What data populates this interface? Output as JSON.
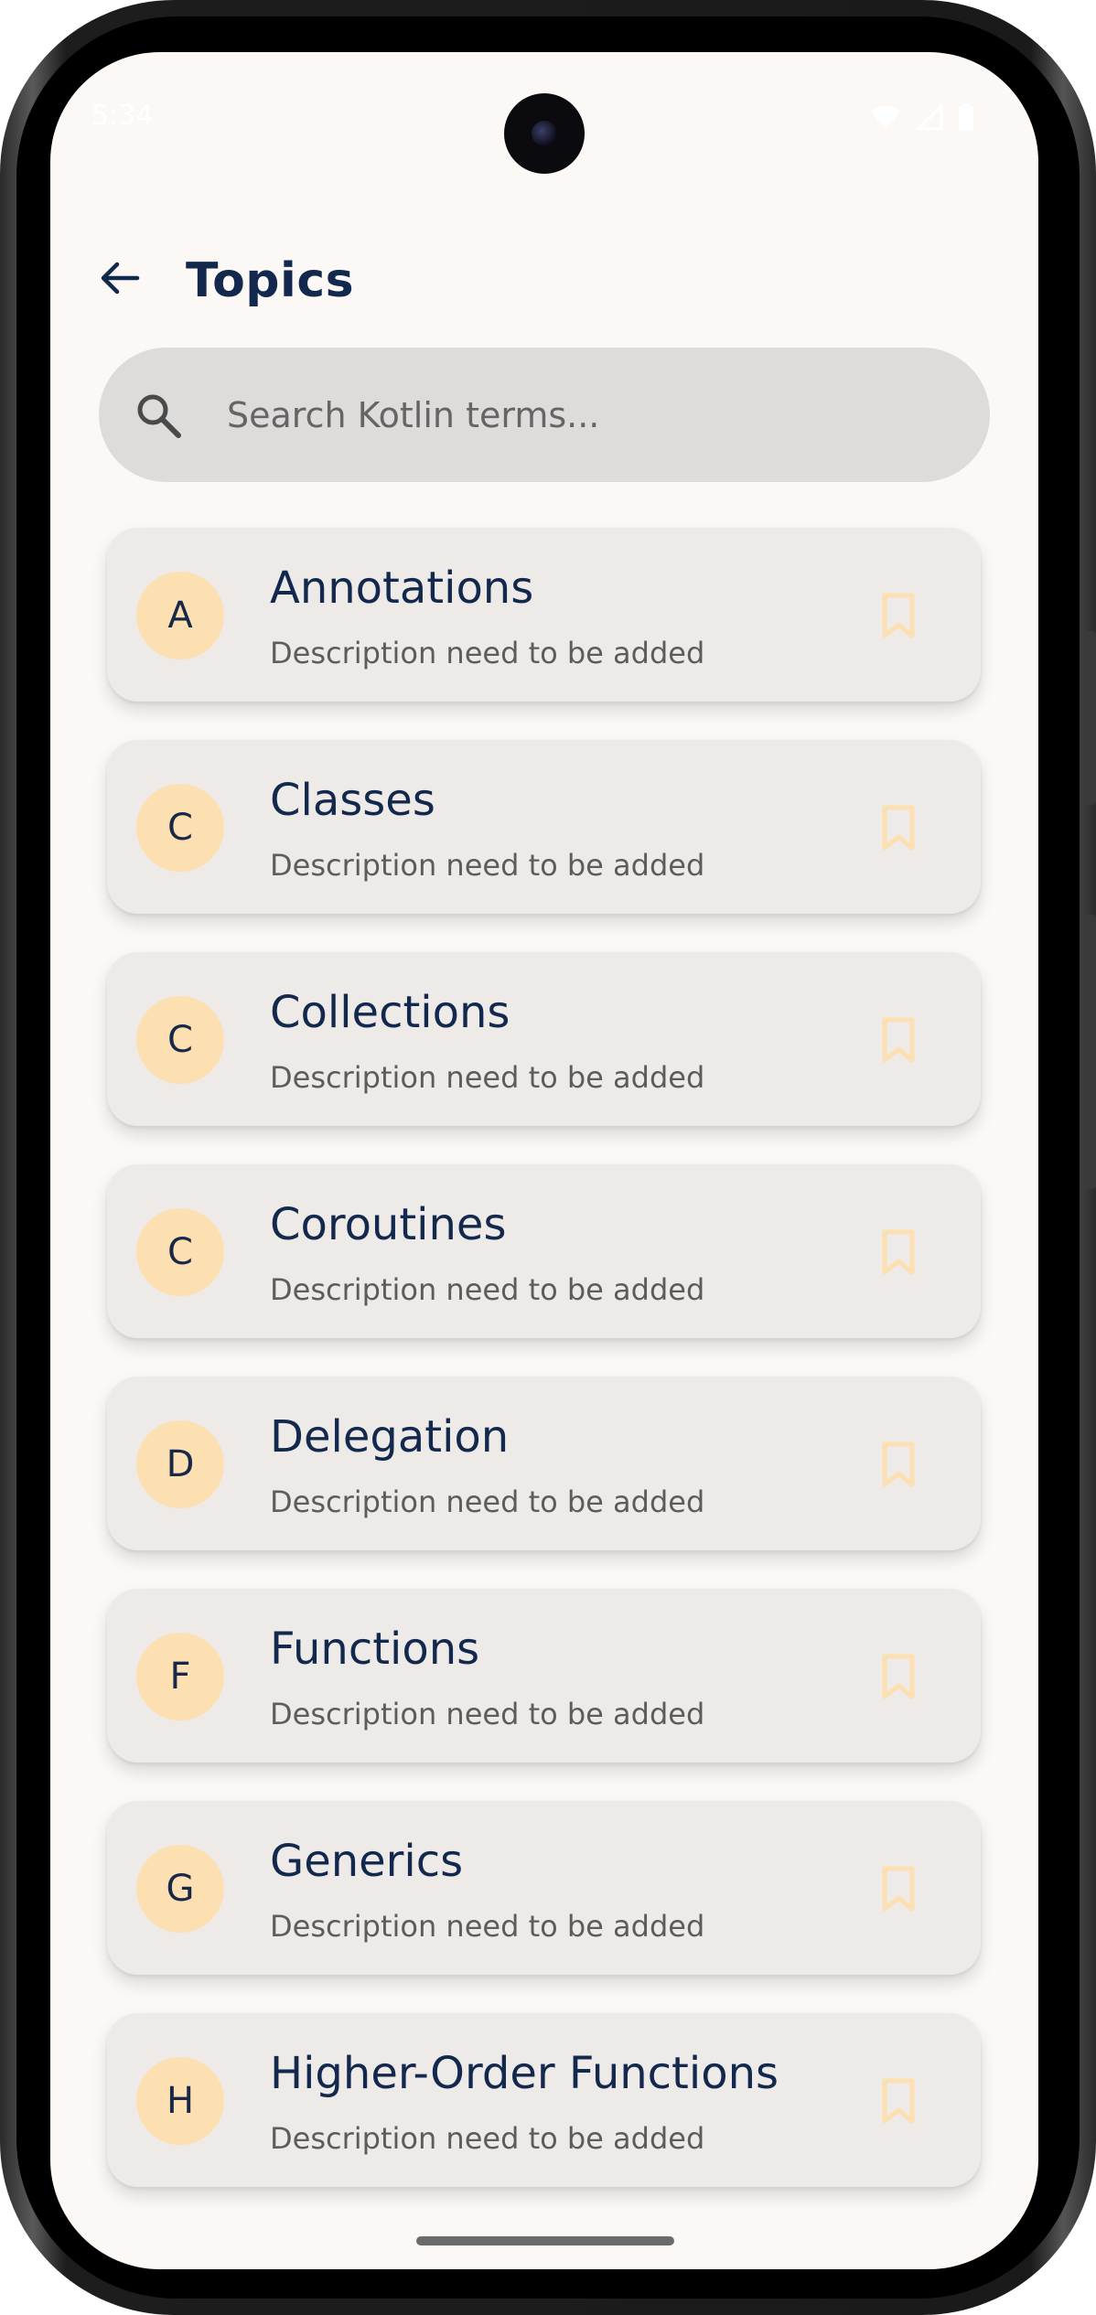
{
  "status_bar": {
    "time": "5:34"
  },
  "app_bar": {
    "title": "Topics",
    "back_icon": "arrow-back-icon"
  },
  "search": {
    "placeholder": "Search Kotlin terms...",
    "value": "",
    "icon": "search-icon"
  },
  "topics": [
    {
      "initial": "A",
      "title": "Annotations",
      "description": "Description need to be added"
    },
    {
      "initial": "C",
      "title": "Classes",
      "description": "Description need to be added"
    },
    {
      "initial": "C",
      "title": "Collections",
      "description": "Description need to be added"
    },
    {
      "initial": "C",
      "title": "Coroutines",
      "description": "Description need to be added"
    },
    {
      "initial": "D",
      "title": "Delegation",
      "description": "Description need to be added"
    },
    {
      "initial": "F",
      "title": "Functions",
      "description": "Description need to be added"
    },
    {
      "initial": "G",
      "title": "Generics",
      "description": "Description need to be added"
    },
    {
      "initial": "H",
      "title": "Higher-Order Functions",
      "description": "Description need to be added"
    }
  ],
  "colors": {
    "title_text": "#13284d",
    "avatar_bg": "#fde0b1",
    "bookmark_outline": "#fde0b1",
    "card_bg": "#eeeae8",
    "screen_bg": "#fcf8f6",
    "search_bg": "#dedcdb"
  }
}
